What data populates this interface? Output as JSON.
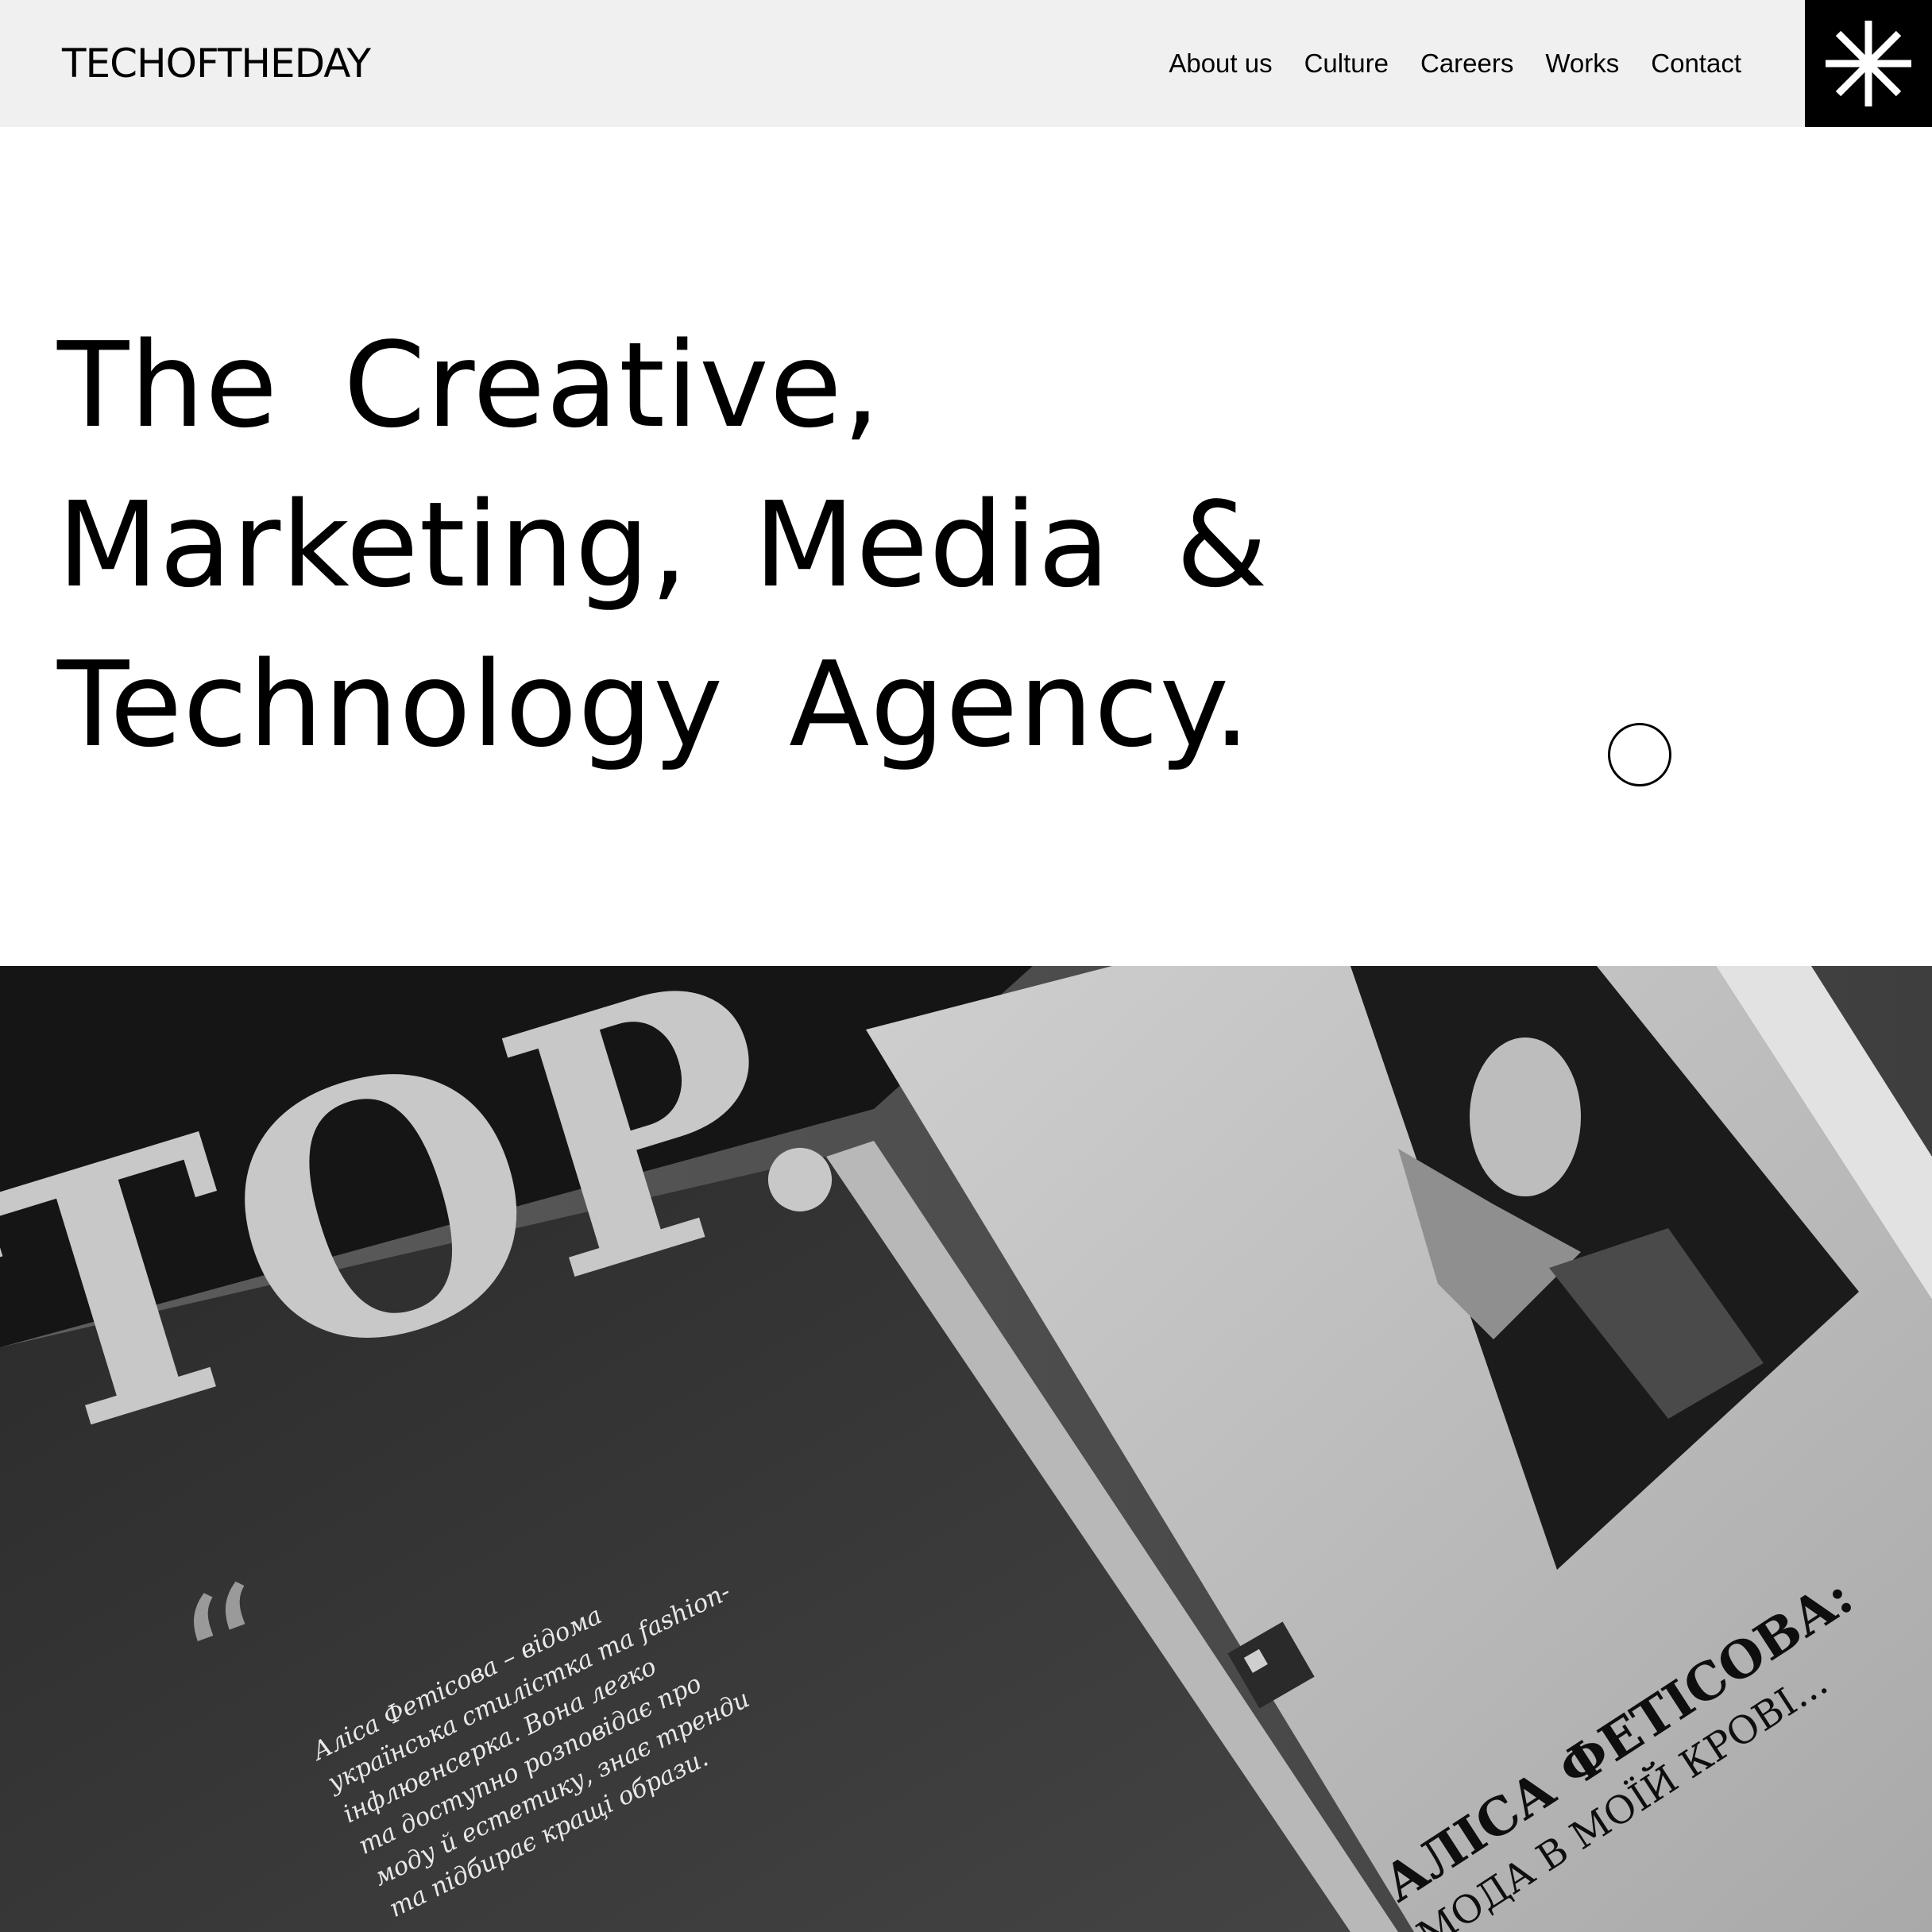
{
  "header": {
    "logo_text": "TECHOFTHEDAY",
    "nav": [
      {
        "label": "About us"
      },
      {
        "label": "Culture"
      },
      {
        "label": "Careers"
      },
      {
        "label": "Works"
      },
      {
        "label": "Contact"
      }
    ],
    "menu_icon": "asterisk-icon"
  },
  "hero": {
    "title_lines": [
      "The Creative,",
      "Marketing, Media &",
      "Technology Agency."
    ],
    "indicator_icon": "circle-outline-icon"
  },
  "feature_image": {
    "description_icon": "magazine-photo",
    "cover_text": "TOP.",
    "quote_lines": [
      "Аліса Фетісова – відома",
      "українська стилістка та fashion-",
      "інфлюенсерка. Вона легко",
      "та доступно розповідає про",
      "моду й естетику, знає тренди",
      "та підбирає кращі образи."
    ],
    "headline_lines": [
      "АЛІСА ФЕТІСОВА:",
      "МОДА В МОЇЙ КРОВІ..."
    ]
  },
  "colors": {
    "header_bg": "#f0f0f0",
    "menu_bg": "#000000",
    "text": "#000000"
  }
}
